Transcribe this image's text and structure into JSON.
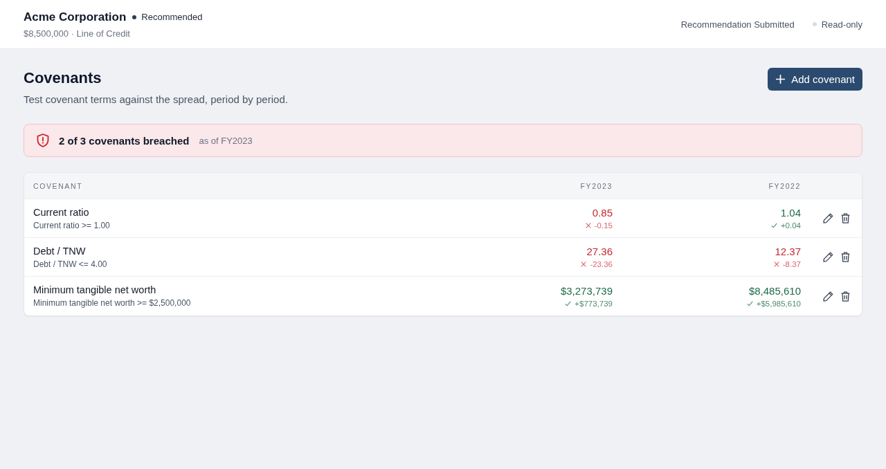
{
  "header": {
    "company": "Acme Corporation",
    "status": "Recommended",
    "summary": "$8,500,000 · Line of Credit",
    "state": "Recommendation Submitted",
    "mode": "Read-only"
  },
  "page": {
    "title": "Covenants",
    "subtitle": "Test covenant terms against the spread, period by period.",
    "add_button": "Add covenant"
  },
  "alert": {
    "message": "2 of 3 covenants breached",
    "as_of": "as of FY2023"
  },
  "table": {
    "columns": [
      "COVENANT",
      "FY2023",
      "FY2022"
    ],
    "rows": [
      {
        "cells": [
          {
            "name": "Current ratio",
            "rule": "Current ratio >= 1.00"
          },
          {
            "value": "0.85",
            "delta": "-0.15",
            "passed": false
          },
          {
            "value": "1.04",
            "delta": "+0.04",
            "passed": true
          }
        ]
      },
      {
        "cells": [
          {
            "name": "Debt / TNW",
            "rule": "Debt / TNW <= 4.00"
          },
          {
            "value": "27.36",
            "delta": "-23.36",
            "passed": false
          },
          {
            "value": "12.37",
            "delta": "-8.37",
            "passed": false
          }
        ]
      },
      {
        "cells": [
          {
            "name": "Minimum tangible net worth",
            "rule": "Minimum tangible net worth >= $2,500,000"
          },
          {
            "value": "$3,273,739",
            "delta": "+$773,739",
            "passed": true
          },
          {
            "value": "$8,485,610",
            "delta": "+$5,985,610",
            "passed": true
          }
        ]
      }
    ]
  }
}
